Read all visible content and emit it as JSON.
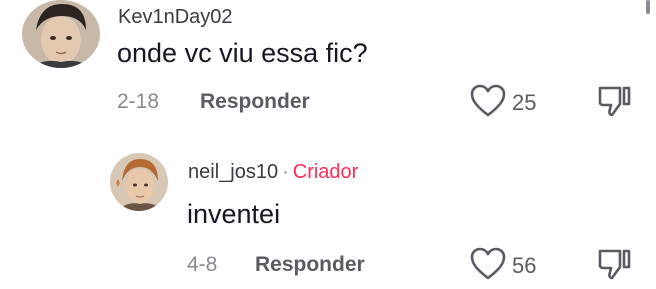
{
  "comments": [
    {
      "username": "Kev1nDay02",
      "is_creator": false,
      "text": "onde vc viu essa fic?",
      "date": "2-18",
      "reply_label": "Responder",
      "likes": "25"
    },
    {
      "username": "neil_jos10",
      "creator_separator": "·",
      "creator_label": "Criador",
      "is_creator": true,
      "text": "inventei",
      "date": "4-8",
      "reply_label": "Responder",
      "likes": "56"
    }
  ],
  "colors": {
    "creator": "#fe2c55",
    "text": "#161823",
    "muted": "#8a8b91",
    "action": "#5b5c63"
  },
  "icons": {
    "like": "heart-outline-icon",
    "dislike": "thumbs-down-outline-icon"
  }
}
